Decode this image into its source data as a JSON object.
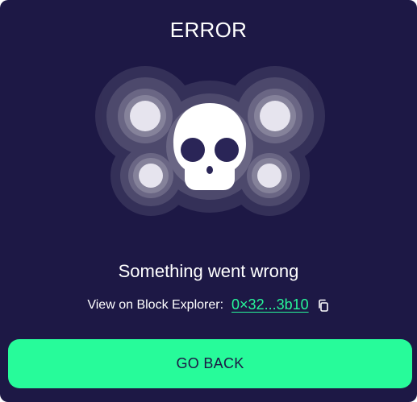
{
  "dialog": {
    "title": "ERROR",
    "message": "Something went wrong",
    "explorer_label": "View on Block Explorer:",
    "tx_hash": "0×32...3b10",
    "button_label": "GO BACK"
  },
  "icons": {
    "illustration": "skull-icon",
    "copy": "copy-icon"
  },
  "colors": {
    "background": "#1d1845",
    "accent": "#27fb9a",
    "text": "#ffffff"
  }
}
